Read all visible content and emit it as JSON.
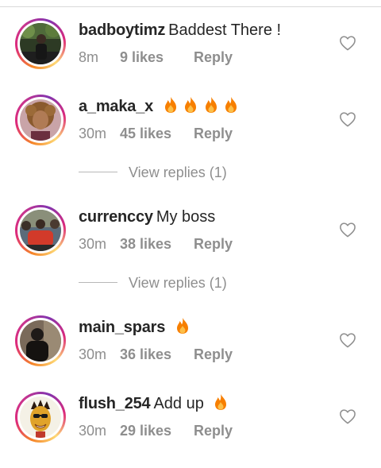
{
  "comments": [
    {
      "avatar": "avatar-photo-dark-outdoor",
      "username": "badboytimz",
      "text": "Baddest There !",
      "fire_count": 0,
      "time": "8m",
      "likes": "9 likes",
      "reply_label": "Reply",
      "view_replies": null
    },
    {
      "avatar": "avatar-photo-woman-curly-hair",
      "username": "a_maka_x",
      "text": "",
      "fire_count": 4,
      "time": "30m",
      "likes": "45 likes",
      "reply_label": "Reply",
      "view_replies": "View replies (1)"
    },
    {
      "avatar": "avatar-photo-crowd-red",
      "username": "currenccy",
      "text": "My boss",
      "fire_count": 0,
      "time": "30m",
      "likes": "38 likes",
      "reply_label": "Reply",
      "view_replies": "View replies (1)"
    },
    {
      "avatar": "avatar-photo-dark-figure",
      "username": "main_spars",
      "text": "",
      "fire_count": 1,
      "time": "30m",
      "likes": "36 likes",
      "reply_label": "Reply",
      "view_replies": null
    },
    {
      "avatar": "avatar-cartoon-face",
      "username": "flush_254",
      "text": "Add up",
      "fire_count": 1,
      "time": "30m",
      "likes": "29 likes",
      "reply_label": "Reply",
      "view_replies": null
    }
  ],
  "icons": {
    "like": "heart-outline-icon",
    "emoji": "fire-emoji"
  },
  "colors": {
    "text_primary": "#262626",
    "text_secondary": "#8e8e8e",
    "story_ring_start": "#f58529",
    "story_ring_mid": "#dd2a7b",
    "story_ring_end": "#8134af",
    "fire_outer": "#f77f00",
    "fire_inner": "#fcbf49"
  }
}
